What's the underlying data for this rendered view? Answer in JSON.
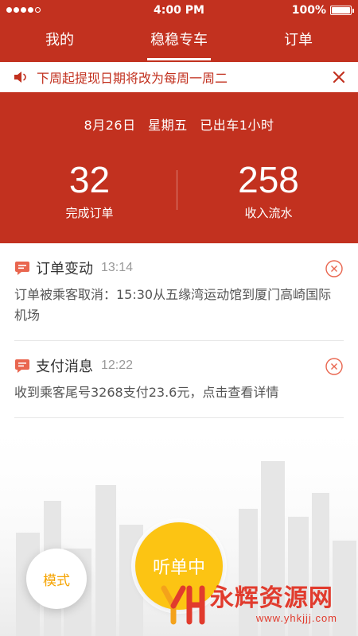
{
  "status_bar": {
    "time": "4:00 PM",
    "battery": "100%",
    "signal_bars": 4
  },
  "tabs": [
    {
      "label": "我的",
      "active": false
    },
    {
      "label": "稳稳专车",
      "active": true
    },
    {
      "label": "订单",
      "active": false
    }
  ],
  "notice": {
    "text": "下周起提现日期将改为每周一周二",
    "icon": "speaker-icon",
    "close_icon": "close-icon"
  },
  "summary": {
    "date": "8月26日",
    "weekday": "星期五",
    "duration": "已出车1小时",
    "completed_orders": {
      "value": "32",
      "label": "完成订单"
    },
    "income": {
      "value": "258",
      "label": "收入流水"
    }
  },
  "messages": [
    {
      "title": "订单变动",
      "time": "13:14",
      "body": "订单被乘客取消：15:30从五缘湾运动馆到厦门高崎国际机场"
    },
    {
      "title": "支付消息",
      "time": "12:22",
      "body": "收到乘客尾号3268支付23.6元，点击查看详情"
    }
  ],
  "controls": {
    "mode_label": "模式",
    "listen_label": "听单中"
  },
  "watermark": {
    "name": "永辉资源网",
    "url": "www.yhkjjj.com"
  },
  "colors": {
    "brand_red": "#c2311f",
    "accent_yellow": "#fcc413",
    "mode_text": "#f5a300"
  }
}
